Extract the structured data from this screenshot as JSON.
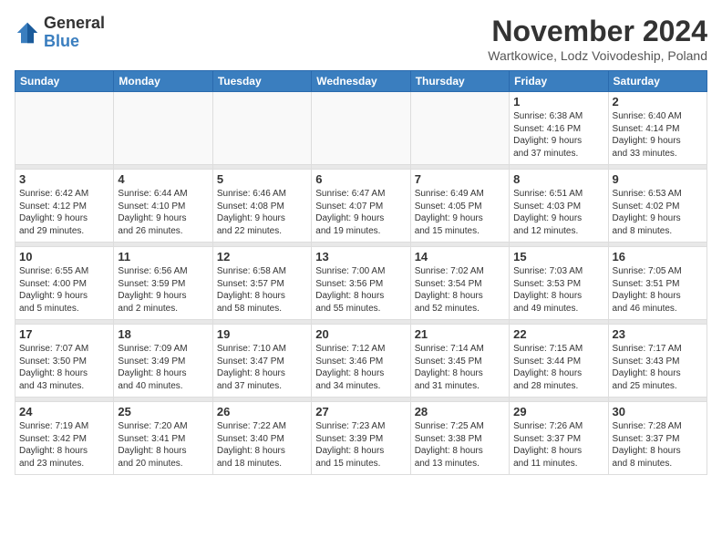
{
  "logo": {
    "general": "General",
    "blue": "Blue"
  },
  "title": "November 2024",
  "location": "Wartkowice, Lodz Voivodeship, Poland",
  "weekdays": [
    "Sunday",
    "Monday",
    "Tuesday",
    "Wednesday",
    "Thursday",
    "Friday",
    "Saturday"
  ],
  "weeks": [
    [
      {
        "day": "",
        "info": ""
      },
      {
        "day": "",
        "info": ""
      },
      {
        "day": "",
        "info": ""
      },
      {
        "day": "",
        "info": ""
      },
      {
        "day": "",
        "info": ""
      },
      {
        "day": "1",
        "info": "Sunrise: 6:38 AM\nSunset: 4:16 PM\nDaylight: 9 hours\nand 37 minutes."
      },
      {
        "day": "2",
        "info": "Sunrise: 6:40 AM\nSunset: 4:14 PM\nDaylight: 9 hours\nand 33 minutes."
      }
    ],
    [
      {
        "day": "3",
        "info": "Sunrise: 6:42 AM\nSunset: 4:12 PM\nDaylight: 9 hours\nand 29 minutes."
      },
      {
        "day": "4",
        "info": "Sunrise: 6:44 AM\nSunset: 4:10 PM\nDaylight: 9 hours\nand 26 minutes."
      },
      {
        "day": "5",
        "info": "Sunrise: 6:46 AM\nSunset: 4:08 PM\nDaylight: 9 hours\nand 22 minutes."
      },
      {
        "day": "6",
        "info": "Sunrise: 6:47 AM\nSunset: 4:07 PM\nDaylight: 9 hours\nand 19 minutes."
      },
      {
        "day": "7",
        "info": "Sunrise: 6:49 AM\nSunset: 4:05 PM\nDaylight: 9 hours\nand 15 minutes."
      },
      {
        "day": "8",
        "info": "Sunrise: 6:51 AM\nSunset: 4:03 PM\nDaylight: 9 hours\nand 12 minutes."
      },
      {
        "day": "9",
        "info": "Sunrise: 6:53 AM\nSunset: 4:02 PM\nDaylight: 9 hours\nand 8 minutes."
      }
    ],
    [
      {
        "day": "10",
        "info": "Sunrise: 6:55 AM\nSunset: 4:00 PM\nDaylight: 9 hours\nand 5 minutes."
      },
      {
        "day": "11",
        "info": "Sunrise: 6:56 AM\nSunset: 3:59 PM\nDaylight: 9 hours\nand 2 minutes."
      },
      {
        "day": "12",
        "info": "Sunrise: 6:58 AM\nSunset: 3:57 PM\nDaylight: 8 hours\nand 58 minutes."
      },
      {
        "day": "13",
        "info": "Sunrise: 7:00 AM\nSunset: 3:56 PM\nDaylight: 8 hours\nand 55 minutes."
      },
      {
        "day": "14",
        "info": "Sunrise: 7:02 AM\nSunset: 3:54 PM\nDaylight: 8 hours\nand 52 minutes."
      },
      {
        "day": "15",
        "info": "Sunrise: 7:03 AM\nSunset: 3:53 PM\nDaylight: 8 hours\nand 49 minutes."
      },
      {
        "day": "16",
        "info": "Sunrise: 7:05 AM\nSunset: 3:51 PM\nDaylight: 8 hours\nand 46 minutes."
      }
    ],
    [
      {
        "day": "17",
        "info": "Sunrise: 7:07 AM\nSunset: 3:50 PM\nDaylight: 8 hours\nand 43 minutes."
      },
      {
        "day": "18",
        "info": "Sunrise: 7:09 AM\nSunset: 3:49 PM\nDaylight: 8 hours\nand 40 minutes."
      },
      {
        "day": "19",
        "info": "Sunrise: 7:10 AM\nSunset: 3:47 PM\nDaylight: 8 hours\nand 37 minutes."
      },
      {
        "day": "20",
        "info": "Sunrise: 7:12 AM\nSunset: 3:46 PM\nDaylight: 8 hours\nand 34 minutes."
      },
      {
        "day": "21",
        "info": "Sunrise: 7:14 AM\nSunset: 3:45 PM\nDaylight: 8 hours\nand 31 minutes."
      },
      {
        "day": "22",
        "info": "Sunrise: 7:15 AM\nSunset: 3:44 PM\nDaylight: 8 hours\nand 28 minutes."
      },
      {
        "day": "23",
        "info": "Sunrise: 7:17 AM\nSunset: 3:43 PM\nDaylight: 8 hours\nand 25 minutes."
      }
    ],
    [
      {
        "day": "24",
        "info": "Sunrise: 7:19 AM\nSunset: 3:42 PM\nDaylight: 8 hours\nand 23 minutes."
      },
      {
        "day": "25",
        "info": "Sunrise: 7:20 AM\nSunset: 3:41 PM\nDaylight: 8 hours\nand 20 minutes."
      },
      {
        "day": "26",
        "info": "Sunrise: 7:22 AM\nSunset: 3:40 PM\nDaylight: 8 hours\nand 18 minutes."
      },
      {
        "day": "27",
        "info": "Sunrise: 7:23 AM\nSunset: 3:39 PM\nDaylight: 8 hours\nand 15 minutes."
      },
      {
        "day": "28",
        "info": "Sunrise: 7:25 AM\nSunset: 3:38 PM\nDaylight: 8 hours\nand 13 minutes."
      },
      {
        "day": "29",
        "info": "Sunrise: 7:26 AM\nSunset: 3:37 PM\nDaylight: 8 hours\nand 11 minutes."
      },
      {
        "day": "30",
        "info": "Sunrise: 7:28 AM\nSunset: 3:37 PM\nDaylight: 8 hours\nand 8 minutes."
      }
    ]
  ]
}
